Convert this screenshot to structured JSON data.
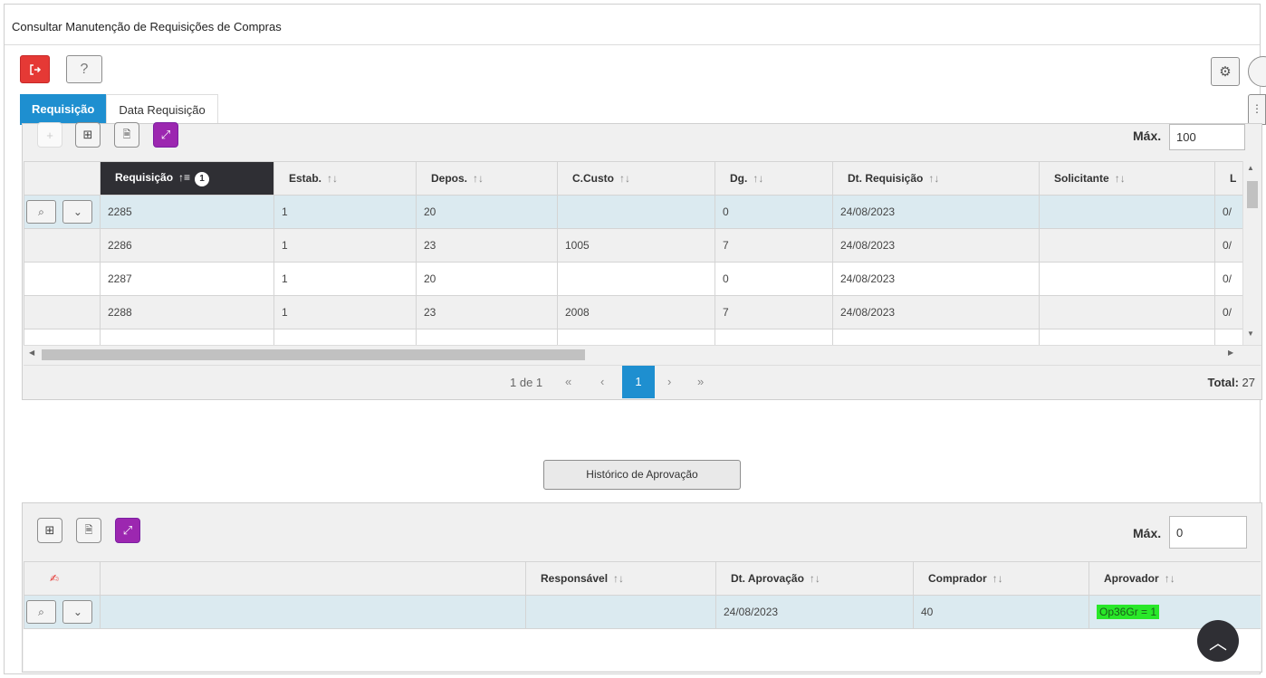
{
  "window": {
    "title": "Consultar Manutenção de Requisições de Compras"
  },
  "toolbar": {
    "exit_icon": "exit-icon",
    "help_label": "?",
    "gear_icon": "gear-icon"
  },
  "tabs": [
    {
      "label": "Requisição",
      "active": true
    },
    {
      "label": "Data Requisição",
      "active": false
    }
  ],
  "grid1": {
    "max_label": "Máx.",
    "max_value": "100",
    "columns": [
      "",
      "Requisição",
      "Estab.",
      "Depos.",
      "C.Custo",
      "Dg.",
      "Dt. Requisição",
      "Solicitante",
      "L"
    ],
    "sort_badge": "1",
    "rows": [
      {
        "requisicao": "2285",
        "estab": "1",
        "depos": "20",
        "ccusto": "",
        "dg": "0",
        "dt": "24/08/2023",
        "solicitante": "",
        "l": "0/"
      },
      {
        "requisicao": "2286",
        "estab": "1",
        "depos": "23",
        "ccusto": "1005",
        "dg": "7",
        "dt": "24/08/2023",
        "solicitante": "",
        "l": "0/"
      },
      {
        "requisicao": "2287",
        "estab": "1",
        "depos": "20",
        "ccusto": "",
        "dg": "0",
        "dt": "24/08/2023",
        "solicitante": "",
        "l": "0/"
      },
      {
        "requisicao": "2288",
        "estab": "1",
        "depos": "23",
        "ccusto": "2008",
        "dg": "7",
        "dt": "24/08/2023",
        "solicitante": "",
        "l": "0/"
      }
    ],
    "pager": {
      "info": "1 de 1",
      "current": "1",
      "total_label": "Total:",
      "total": "27"
    }
  },
  "history_button": "Histórico de Aprovação",
  "grid2": {
    "max_label": "Máx.",
    "max_value": "0",
    "columns": [
      "",
      "",
      "Responsável",
      "Dt. Aprovação",
      "Comprador",
      "Aprovador"
    ],
    "rows": [
      {
        "responsavel": "",
        "dt": "24/08/2023",
        "comprador": "40",
        "aprovador": "Op36Gr = 1"
      }
    ]
  }
}
